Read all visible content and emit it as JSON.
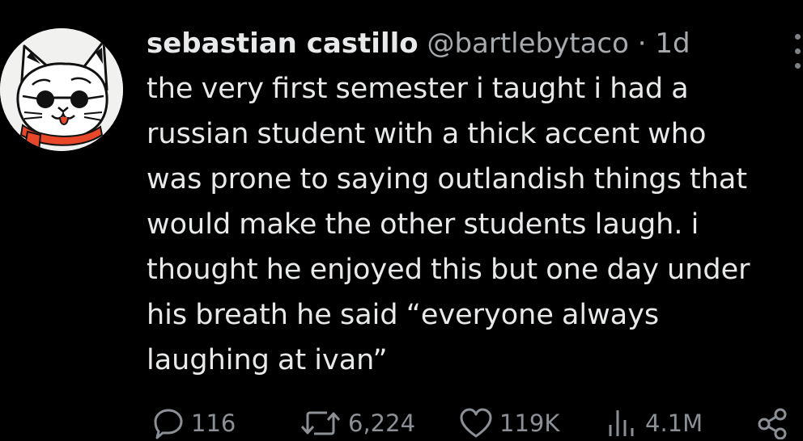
{
  "tweet": {
    "author_name": "sebastian castillo",
    "handle": "@bartlebytaco",
    "separator": "·",
    "time_ago": "1d",
    "text": "the very first semester i taught i had a\nrussian student with a thick accent who\nwas prone to saying outlandish things that\nwould make the other students laugh. i\nthought he enjoyed this but one day under\nhis breath he said “everyone always\nlaughing at ivan”"
  },
  "actions": {
    "replies": "116",
    "reposts": "6,224",
    "likes": "119K",
    "views": "4.1M"
  },
  "icons": {
    "avatar": "cat-with-sunglasses-avatar",
    "more": "more-options-icon",
    "reply": "reply-icon",
    "repost": "repost-icon",
    "like": "heart-icon",
    "views": "views-icon",
    "share": "share-icon"
  },
  "colors": {
    "background": "#000000",
    "text": "#e7e9ea",
    "secondary": "#a6abb0",
    "avatar_scarf": "#e8472a"
  }
}
